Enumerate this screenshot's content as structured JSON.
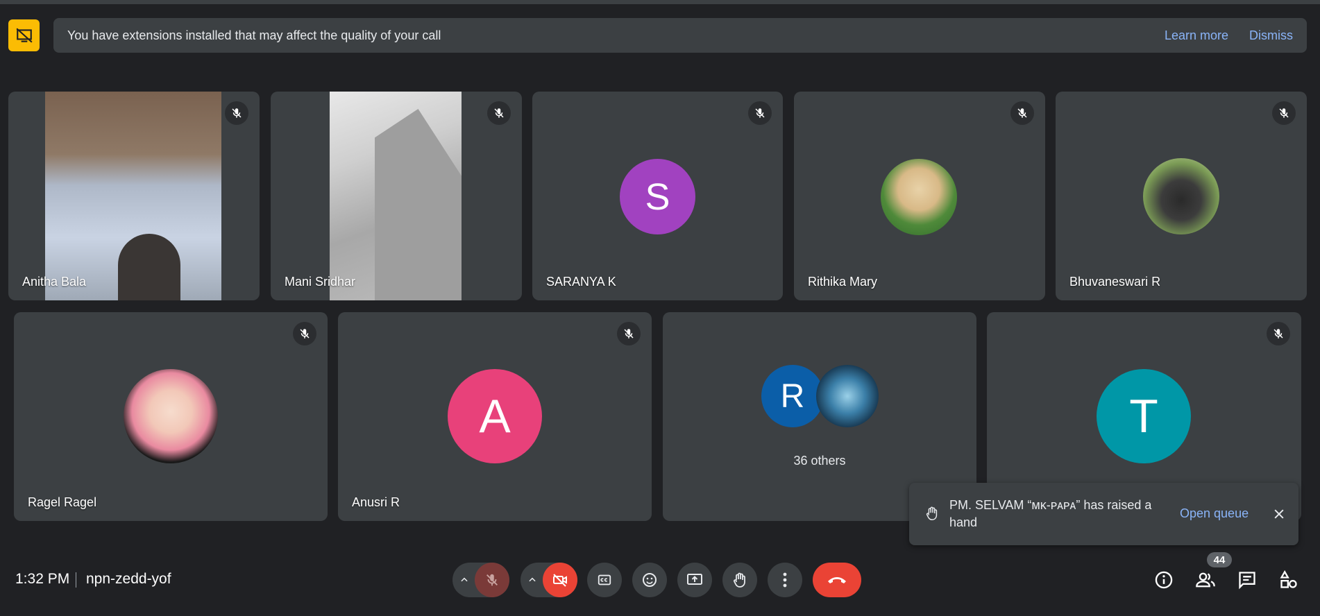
{
  "banner": {
    "text": "You have extensions installed that may affect the quality of your call",
    "learn_more": "Learn more",
    "dismiss": "Dismiss"
  },
  "participants": [
    {
      "name": "Anitha Bala"
    },
    {
      "name": "Mani Sridhar"
    },
    {
      "name": "SARANYA K",
      "initial": "S",
      "color": "#a142c0"
    },
    {
      "name": "Rithika Mary"
    },
    {
      "name": "Bhuvaneswari R"
    },
    {
      "name": "Ragel Ragel"
    },
    {
      "name": "Anusri R",
      "initial": "A",
      "color": "#e8417a"
    },
    {
      "others_label": "36 others",
      "initial": "R",
      "color": "#0b5ea8"
    },
    {
      "initial": "T",
      "color": "#0097a7"
    }
  ],
  "toast": {
    "message": "PM. SELVAM “ᴍᴋ-ᴘᴀᴘᴀ” has raised a hand",
    "open_queue": "Open queue"
  },
  "meeting": {
    "time": "1:32 PM",
    "code": "npn-zedd-yof"
  },
  "people_count": "44",
  "colors": {
    "accent_link": "#8ab4f8",
    "end_call": "#ea4335",
    "banner_icon": "#fbbc04",
    "tile_bg": "#3c4043",
    "page_bg": "#202124"
  }
}
